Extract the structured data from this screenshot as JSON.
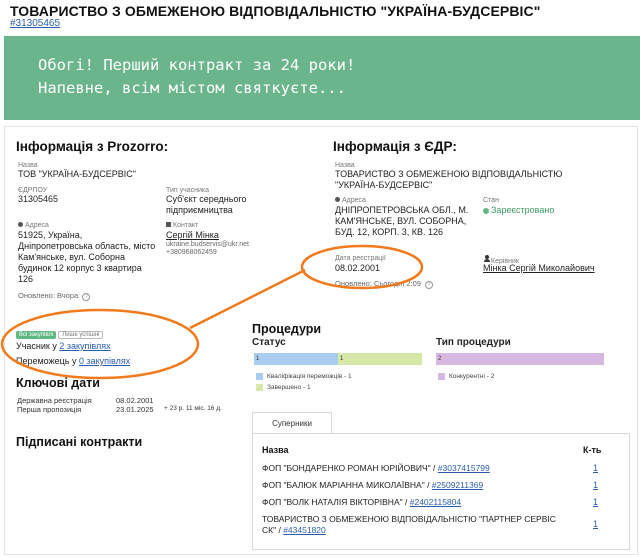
{
  "header": {
    "title": "ТОВАРИСТВО З ОБМЕЖЕНОЮ ВІДПОВІДАЛЬНІСТЮ \"УКРАЇНА-БУДСЕРВІС\"",
    "edrpou_link": "#31305465"
  },
  "banner": {
    "text": "Обогі! Перший контракт за 24 роки!\nНапевне, всім містом святкуєте..."
  },
  "prozorro": {
    "heading": "Інформація з Prozorro:",
    "name_label": "Назва",
    "name": "ТОВ \"УКРАЇНА-БУДСЕРВІС\"",
    "edrpou_label": "ЄДРПОУ",
    "edrpou": "31305465",
    "type_label": "Тип учасника",
    "type": "Суб'єкт середнього підприємництва",
    "address_label": "Адреса",
    "address": "51925, Україна, Дніпропетровська область, місто Кам'янське, вул. Соборна будинок 12 корпус 3 квартира 126",
    "contact_label": "Контакт",
    "contact_name": "Сергій Мінка",
    "contact_email": "ukraine.budservis@ukr.net",
    "contact_phone": "+380968062459",
    "updated": "Оновлено: Вчора"
  },
  "edr": {
    "heading": "Інформація з ЄДР:",
    "name_label": "Назва",
    "name": "ТОВАРИСТВО З ОБМЕЖЕНОЮ ВІДПОВІДАЛЬНІСТЮ \"УКРАЇНА-БУДСЕРВІС\"",
    "address_label": "Адреса",
    "address": "ДНІПРОПЕТРОВСЬКА ОБЛ., М. КАМ'ЯНСЬКЕ, ВУЛ. СОБОРНА, БУД. 12, КОРП. 3, КВ. 126",
    "status_label": "Стан",
    "status": "Зареєстровано",
    "reg_date_label": "Дата реєстрації",
    "reg_date": "08.02.2001",
    "head_label": "Керівник",
    "head": "Мінка Сергій Миколайович",
    "updated": "Оновлено: Сьогодні 2:09"
  },
  "participation": {
    "badge_active": "Всі закупівлі",
    "badge_lost": "Лише успішні",
    "participant_prefix": "Учасник у ",
    "participant_link": "2 закупівлях",
    "winner_prefix": "Переможець у ",
    "winner_link": "0 закупівлях"
  },
  "key_dates": {
    "heading": "Ключові дати",
    "rows": [
      {
        "label": "Державна реєстрація",
        "value": "08.02.2001",
        "extra": ""
      },
      {
        "label": "Перша пропозиція",
        "value": "23.01.2025",
        "extra": "+ 23 р. 11 міс. 16 д."
      }
    ]
  },
  "contracts": {
    "heading": "Підписані контракти"
  },
  "procedures": {
    "heading": "Процедури",
    "status_title": "Статус",
    "type_title": "Тип процедури",
    "status_bar": [
      {
        "label": "1",
        "value": 1,
        "color": "#a9cdf0"
      },
      {
        "label": "1",
        "value": 1,
        "color": "#d5e8a6"
      }
    ],
    "status_legend": [
      {
        "label": "Кваліфікація переможців - 1",
        "color": "#a9cdf0"
      },
      {
        "label": "Завершено - 1",
        "color": "#d5e8a6"
      }
    ],
    "type_bar": [
      {
        "label": "2",
        "value": 2,
        "color": "#d7b8e0"
      }
    ],
    "type_legend": [
      {
        "label": "Конкурентні - 2",
        "color": "#d7b8e0"
      }
    ]
  },
  "suppliers": {
    "tab": "Суперники",
    "col_name": "Назва",
    "col_count": "К-ть",
    "rows": [
      {
        "name": "ФОП \"БОНДАРЕНКО РОМАН ЮРІЙОВИЧ\" / ",
        "id": "#3037415799",
        "count": "1"
      },
      {
        "name": "ФОП \"БАЛЮК МАРІАННА МИКОЛАЇВНА\" / ",
        "id": "#2509211369",
        "count": "1"
      },
      {
        "name": "ФОП \"ВОЛК НАТАЛІЯ ВІКТОРІВНА\" / ",
        "id": "#2402115804",
        "count": "1"
      },
      {
        "name": "ТОВАРИСТВО З ОБМЕЖЕНОЮ ВІДПОВІДАЛЬНІСТЮ \"ПАРТНЕР СЕРВІС СК\" / ",
        "id": "#43451820",
        "count": "1"
      }
    ]
  },
  "colors": {
    "banner": "#6bb58d",
    "annotation": "#f07a1c",
    "link": "#2a5db0"
  }
}
